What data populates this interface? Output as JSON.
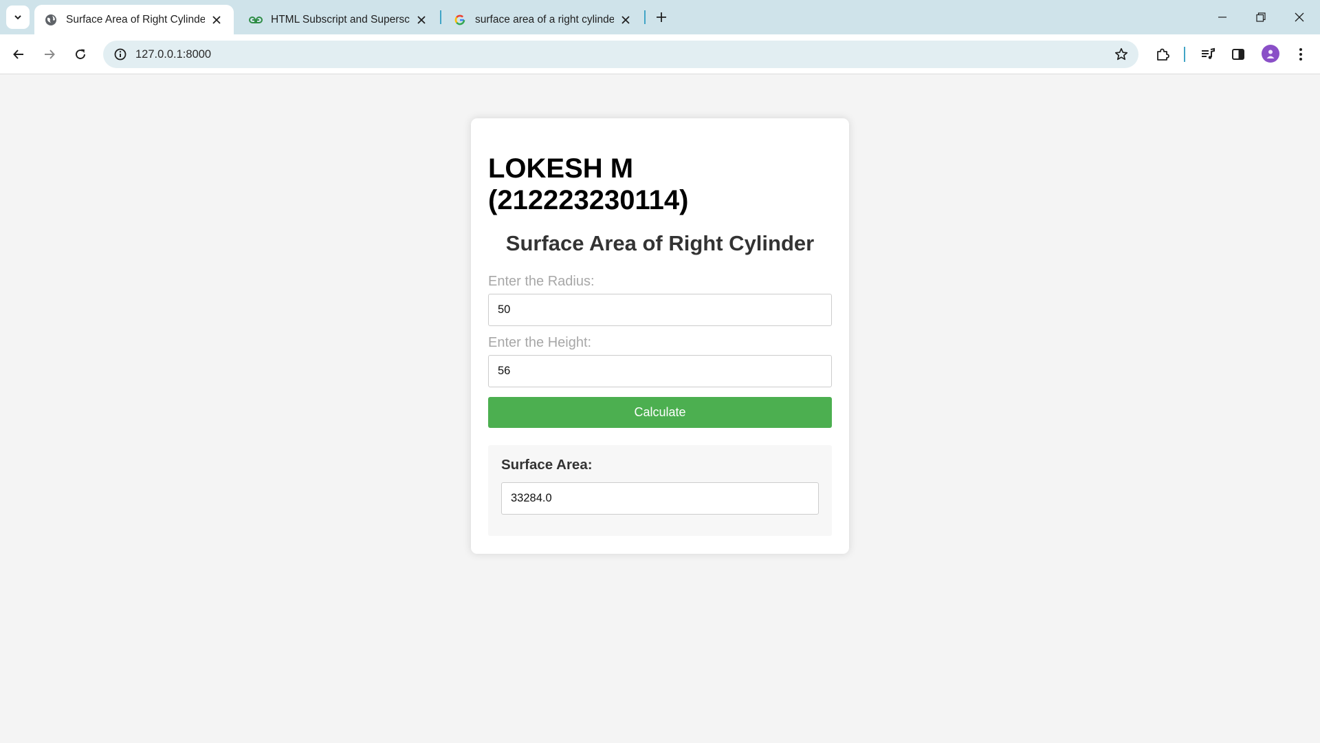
{
  "browser": {
    "tabs": [
      {
        "title": "Surface Area of Right Cylinder",
        "active": true,
        "favicon": "globe-icon"
      },
      {
        "title": "HTML Subscript and Superscrip",
        "active": false,
        "favicon": "gfg-icon"
      },
      {
        "title": "surface area of a right cylinder c",
        "active": false,
        "favicon": "google-icon"
      }
    ],
    "url": "127.0.0.1:8000"
  },
  "page": {
    "student": "LOKESH M (212223230114)",
    "heading": "Surface Area of Right Cylinder",
    "radius": {
      "label": "Enter the Radius:",
      "value": "50"
    },
    "height": {
      "label": "Enter the Height:",
      "value": "56"
    },
    "calculate_label": "Calculate",
    "result": {
      "label": "Surface Area:",
      "value": "33284.0"
    }
  },
  "colors": {
    "tabstrip": "#cfe3ea",
    "button_green": "#4caf50",
    "page_bg": "#f4f4f4",
    "avatar": "#8a4fc7"
  }
}
